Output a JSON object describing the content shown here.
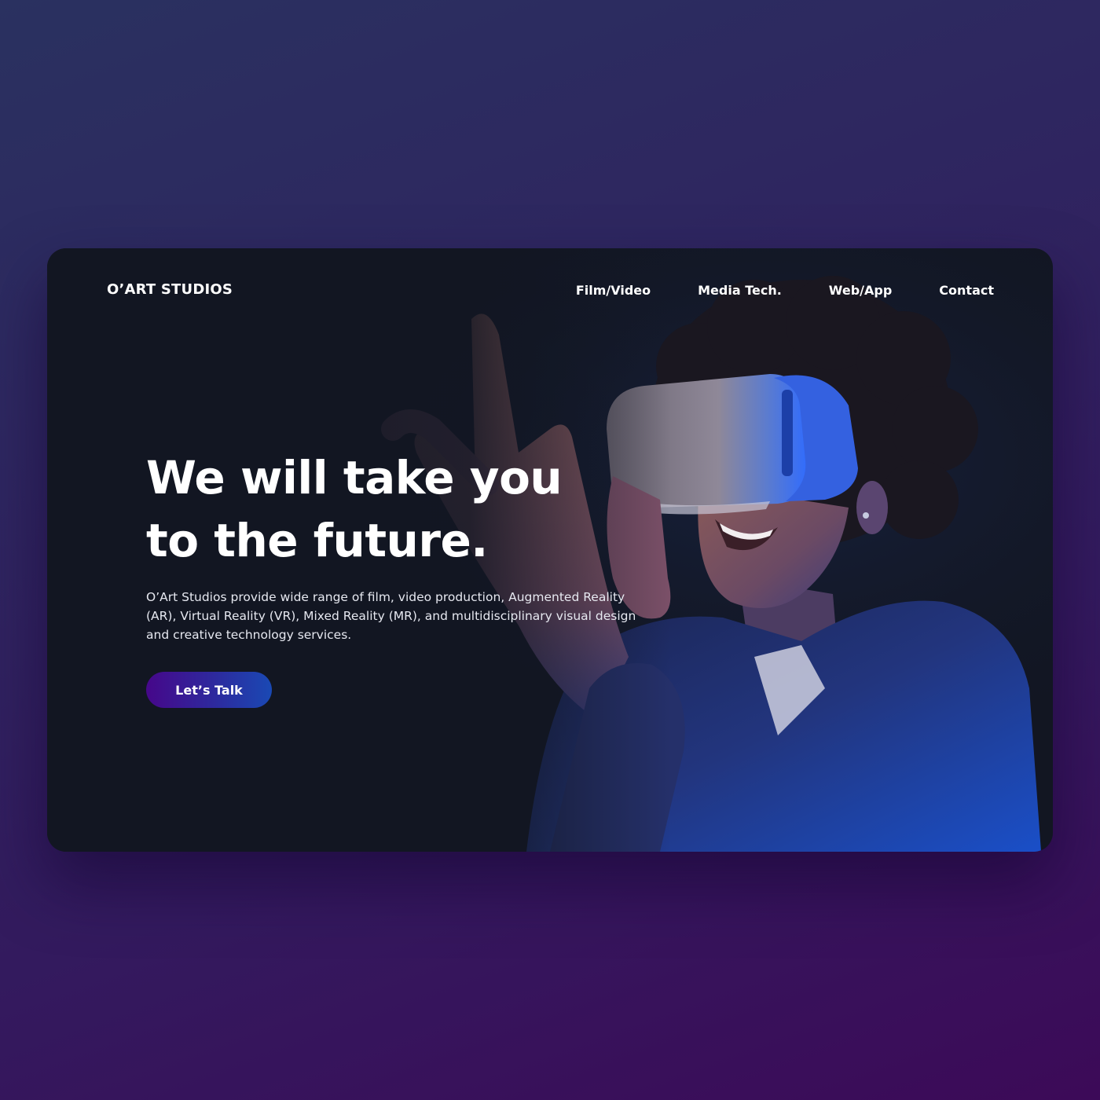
{
  "header": {
    "logo": "O’ART STUDIOS",
    "nav": [
      {
        "label": "Film/Video"
      },
      {
        "label": "Media Tech."
      },
      {
        "label": "Web/App"
      },
      {
        "label": "Contact"
      }
    ]
  },
  "hero": {
    "headline_line1": "We will take you",
    "headline_line2": "to the future.",
    "description": "O’Art Studios provide wide range of film, video production, Augmented Reality (AR), Virtual Reality (VR), Mixed Reality (MR), and multidisciplinary visual design and creative technology services.",
    "cta_label": "Let’s Talk"
  },
  "colors": {
    "page_background_top": "#2a3160",
    "page_background_bottom": "#3c0a58",
    "card_background": "#121622",
    "cta_gradient_start": "#46078a",
    "cta_gradient_end": "#1a49b4",
    "highlight_blue": "#2f6bff"
  }
}
